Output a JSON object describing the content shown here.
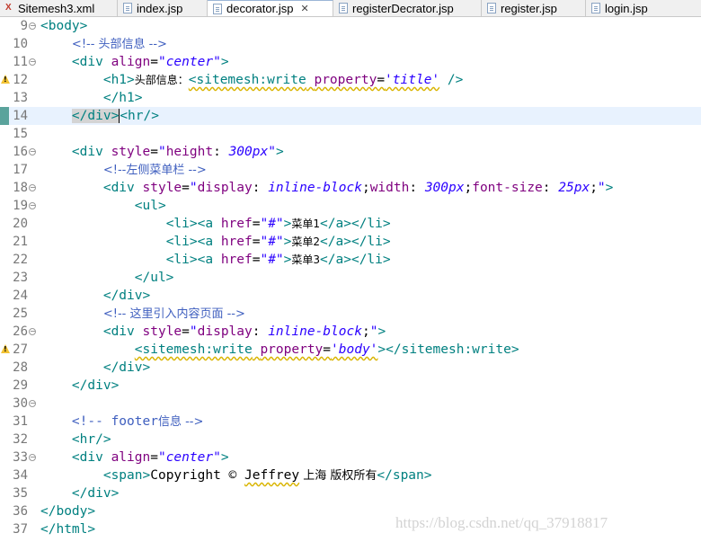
{
  "tabs": [
    {
      "label": "Sitemesh3.xml",
      "active": false
    },
    {
      "label": "index.jsp",
      "active": false
    },
    {
      "label": "decorator.jsp",
      "active": true
    },
    {
      "label": "registerDecrator.jsp",
      "active": false
    },
    {
      "label": "register.jsp",
      "active": false
    },
    {
      "label": "login.jsp",
      "active": false
    }
  ],
  "close_glyph": "✕",
  "line_numbers": [
    "9",
    "10",
    "11",
    "12",
    "13",
    "14",
    "15",
    "16",
    "17",
    "18",
    "19",
    "20",
    "21",
    "22",
    "23",
    "24",
    "25",
    "26",
    "27",
    "28",
    "29",
    "30",
    "31",
    "32",
    "33",
    "34",
    "35",
    "36",
    "37"
  ],
  "code": {
    "l9_body_open": "<body>",
    "l10_comment": "<!-- 头部信息 -->",
    "l11_div_open": "<div",
    "l11_attr": "align",
    "l11_eq": "=",
    "l11_val": "\"center\"",
    "l11_close": ">",
    "l12_h1": "<h1>",
    "l12_text": "头部信息：",
    "l12_tag": "<sitemesh:write",
    "l12_attr": "property",
    "l12_eq": "=",
    "l12_val": "'title'",
    "l12_end": " />",
    "l13_h1_close": "</h1>",
    "l14_div_close": "</div>",
    "l14_hr": "<hr/>",
    "l16_div_open": "<div",
    "l16_attr": "style",
    "l16_eq": "=",
    "l16_q1": "\"",
    "l16_prop": "height",
    "l16_colon": ":",
    "l16_val": "300px",
    "l16_q2": "\"",
    "l16_close": ">",
    "l17_comment": "<!--左侧菜单栏 -->",
    "l18_div_open": "<div",
    "l18_attr": "style",
    "l18_eq": "=",
    "l18_q1": "\"",
    "l18_prop1": "display",
    "l18_colon1": ":",
    "l18_val1": "inline-block",
    "l18_semi1": ";",
    "l18_prop2": "width",
    "l18_colon2": ":",
    "l18_val2": "300px",
    "l18_semi2": ";",
    "l18_prop3": "font-size",
    "l18_colon3": ":",
    "l18_val3": "25px",
    "l18_semi3": ";",
    "l18_q2": "\"",
    "l18_close": ">",
    "l19_ul": "<ul>",
    "li_items": [
      {
        "open": "<li><a",
        "attr": "href",
        "eq": "=",
        "val": "\"#\"",
        "gt": ">",
        "text": "菜单1",
        "close": "</a></li>"
      },
      {
        "open": "<li><a",
        "attr": "href",
        "eq": "=",
        "val": "\"#\"",
        "gt": ">",
        "text": "菜单2",
        "close": "</a></li>"
      },
      {
        "open": "<li><a",
        "attr": "href",
        "eq": "=",
        "val": "\"#\"",
        "gt": ">",
        "text": "菜单3",
        "close": "</a></li>"
      }
    ],
    "l23_ul_close": "</ul>",
    "l24_div_close": "</div>",
    "l25_comment": "<!-- 这里引入内容页面 -->",
    "l26_div_open": "<div",
    "l26_attr": "style",
    "l26_eq": "=",
    "l26_q1": "\"",
    "l26_prop": "display",
    "l26_colon": ":",
    "l26_val": "inline-block",
    "l26_semi": ";",
    "l26_q2": "\"",
    "l26_close": ">",
    "l27_tag": "<sitemesh:write",
    "l27_attr": "property",
    "l27_eq": "=",
    "l27_val": "'body'",
    "l27_end": "></sitemesh:write>",
    "l28_div_close": "</div>",
    "l29_div_close": "</div>",
    "l31_comment_a": "<!-- ",
    "l31_comment_b": "footer",
    "l31_comment_c": "信息 -->",
    "l32_hr": "<hr/>",
    "l33_div_open": "<div",
    "l33_attr": "align",
    "l33_eq": "=",
    "l33_val": "\"center\"",
    "l33_close": ">",
    "l34_span": "<span>",
    "l34_text_a": "Copyright © ",
    "l34_text_b": "Jeffrey",
    "l34_text_c": " 上海 版权所有",
    "l34_span_close": "</span>",
    "l35_div_close": "</div>",
    "l36_body_close": "</body>",
    "l37_html_close": "</html>"
  },
  "watermark": "https://blog.csdn.net/qq_37918817"
}
